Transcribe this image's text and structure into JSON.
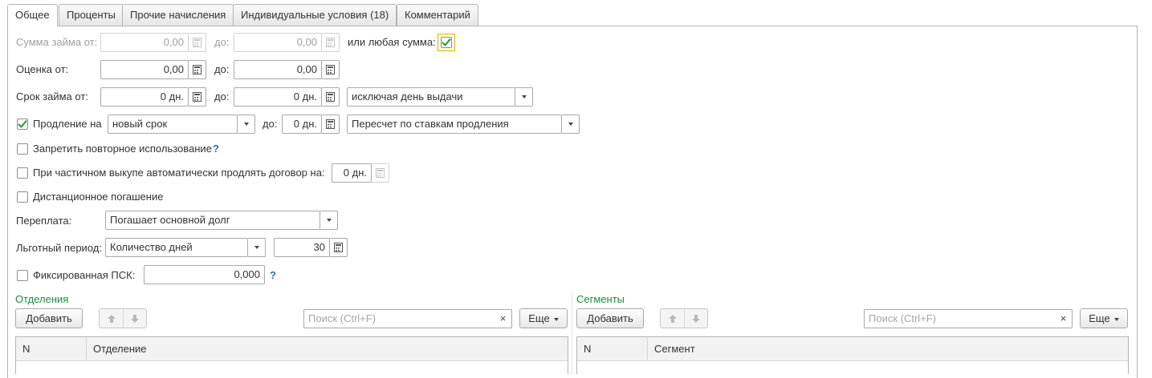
{
  "tabs": [
    {
      "label": "Общее",
      "active": true
    },
    {
      "label": "Проценты",
      "active": false
    },
    {
      "label": "Прочие начисления",
      "active": false
    },
    {
      "label": "Индивидуальные условия (18)",
      "active": false
    },
    {
      "label": "Комментарий",
      "active": false
    }
  ],
  "loan_amount": {
    "label": "Сумма займа от:",
    "from_value": "0,00",
    "to_label": "до:",
    "to_value": "0,00",
    "any_amount_label": "или любая сумма:",
    "any_amount_checked": true
  },
  "score": {
    "label": "Оценка от:",
    "from_value": "0,00",
    "to_label": "до:",
    "to_value": "0,00"
  },
  "loan_term": {
    "label": "Срок займа от:",
    "from_value": "0 дн.",
    "to_label": "до:",
    "to_value": "0 дн.",
    "mode": "исключая день выдачи"
  },
  "extension": {
    "checked": true,
    "label": "Продление на",
    "type": "новый срок",
    "to_label": "до:",
    "to_value": "0 дн.",
    "recalc": "Пересчет по ставкам продления"
  },
  "options": {
    "forbid_reuse_label": "Запретить повторное использование",
    "forbid_reuse_help": "?",
    "partial_buyout_label": "При частичном выкупе автоматически продлять договор на:",
    "partial_buyout_value": "0 дн.",
    "remote_repayment_label": "Дистанционное погашение"
  },
  "overpayment": {
    "label": "Переплата:",
    "value": "Погашает основной долг"
  },
  "grace_period": {
    "label": "Льготный период:",
    "type": "Количество дней",
    "value": "30"
  },
  "fixed_psk": {
    "label": "Фиксированная ПСК:",
    "value": "0,000",
    "help": "?"
  },
  "branches": {
    "title": "Отделения",
    "add_label": "Добавить",
    "search_placeholder": "Поиск (Ctrl+F)",
    "clear": "×",
    "more_label": "Еще",
    "columns": [
      "N",
      "Отделение"
    ]
  },
  "segments": {
    "title": "Сегменты",
    "add_label": "Добавить",
    "search_placeholder": "Поиск (Ctrl+F)",
    "clear": "×",
    "more_label": "Еще",
    "columns": [
      "N",
      "Сегмент"
    ]
  },
  "icons": {
    "calculator": "calculator-icon",
    "dropdown": "chevron-down-icon",
    "up": "arrow-up-icon",
    "down": "arrow-down-icon",
    "check": "check-icon"
  },
  "colors": {
    "accent_green": "#1e8c3a",
    "help_blue": "#2a6dc0",
    "check_green": "#1b9a3d"
  }
}
